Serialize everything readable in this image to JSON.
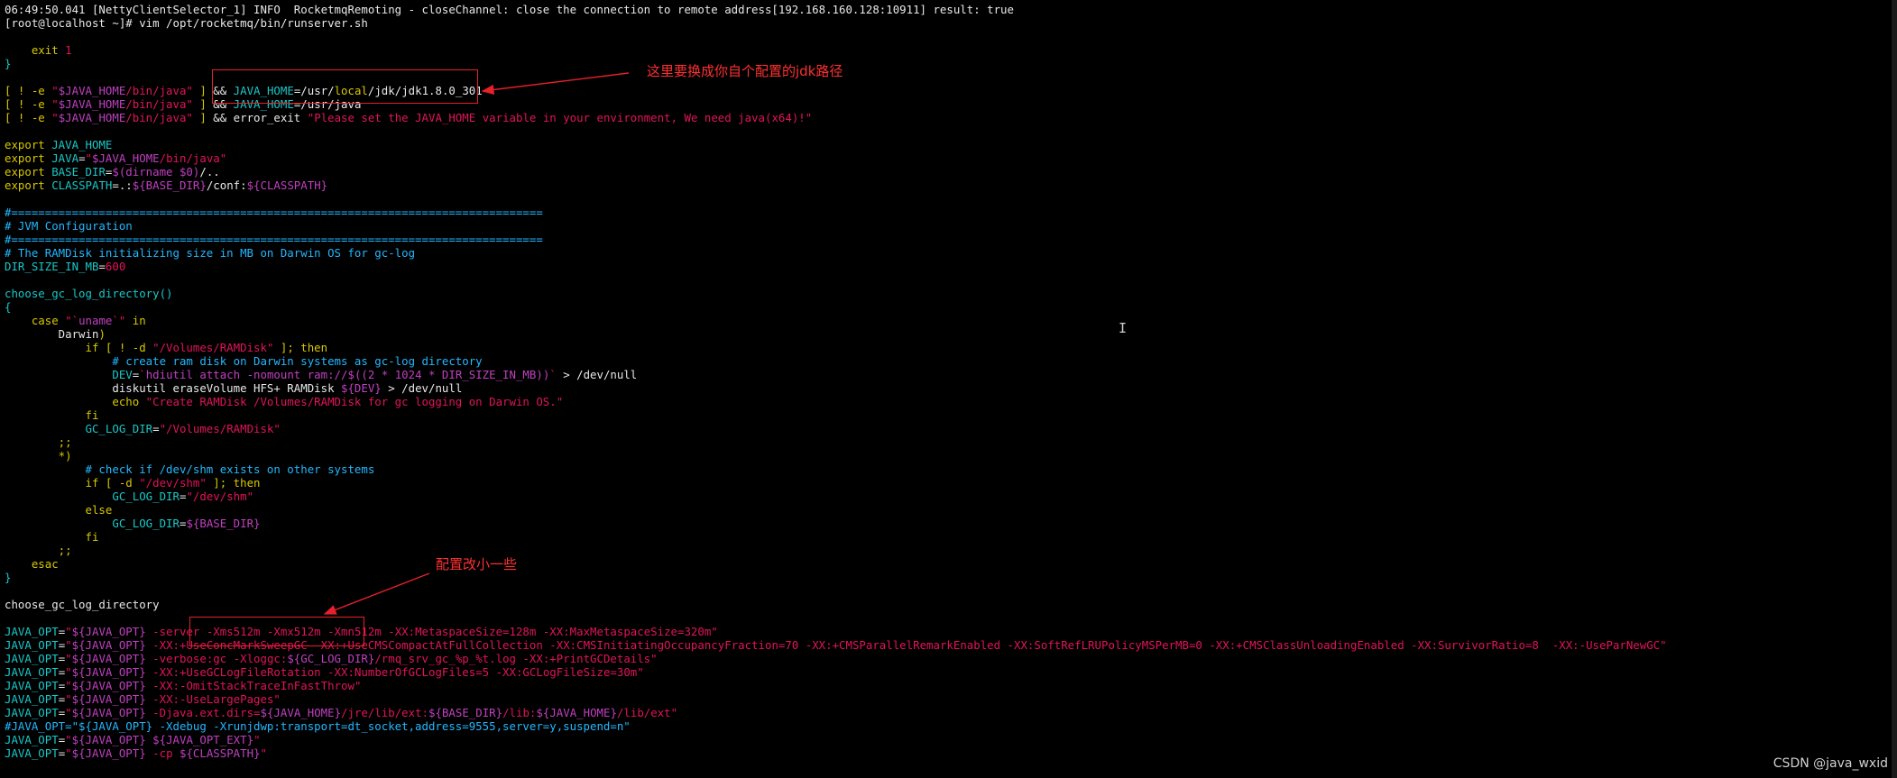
{
  "terminal": {
    "lines": [
      [
        {
          "c": "pl",
          "t": "06:49:50.041 [NettyClientSelector_1] INFO  RocketmqRemoting - closeChannel: close the connection to remote address[192.168.160.128:10911] result: true"
        }
      ],
      [
        {
          "c": "pl",
          "t": "[root@localhost ~]# vim /opt/rocketmq/bin/runserver.sh"
        }
      ],
      [],
      [
        {
          "c": "kw",
          "t": "    exit "
        },
        {
          "c": "nm",
          "t": "1"
        }
      ],
      [
        {
          "c": "vr",
          "t": "}"
        }
      ],
      [],
      [
        {
          "c": "kw",
          "t": "[ ! -e "
        },
        {
          "c": "st",
          "t": "\""
        },
        {
          "c": "va",
          "t": "$JAVA_HOME"
        },
        {
          "c": "st",
          "t": "/bin/java\""
        },
        {
          "c": "kw",
          "t": " ]"
        },
        {
          "c": "pl",
          "t": " && "
        },
        {
          "c": "vr",
          "t": "JAVA_HOME"
        },
        {
          "c": "pl",
          "t": "=/usr/"
        },
        {
          "c": "kw",
          "t": "local"
        },
        {
          "c": "pl",
          "t": "/jdk/jdk1.8.0_301"
        }
      ],
      [
        {
          "c": "kw",
          "t": "[ ! -e "
        },
        {
          "c": "st",
          "t": "\""
        },
        {
          "c": "va",
          "t": "$JAVA_HOME"
        },
        {
          "c": "st",
          "t": "/bin/java\""
        },
        {
          "c": "kw",
          "t": " ]"
        },
        {
          "c": "pl",
          "t": " && "
        },
        {
          "c": "vr",
          "t": "JAVA_HOME"
        },
        {
          "c": "pl",
          "t": "=/usr/java"
        }
      ],
      [
        {
          "c": "kw",
          "t": "[ ! -e "
        },
        {
          "c": "st",
          "t": "\""
        },
        {
          "c": "va",
          "t": "$JAVA_HOME"
        },
        {
          "c": "st",
          "t": "/bin/java\""
        },
        {
          "c": "kw",
          "t": " ]"
        },
        {
          "c": "pl",
          "t": " && error_exit "
        },
        {
          "c": "st",
          "t": "\"Please set the JAVA_HOME variable in your environment, We need java(x64)!\""
        }
      ],
      [],
      [
        {
          "c": "kw",
          "t": "export"
        },
        {
          "c": "vr",
          "t": " JAVA_HOME"
        }
      ],
      [
        {
          "c": "kw",
          "t": "export"
        },
        {
          "c": "vr",
          "t": " JAVA"
        },
        {
          "c": "pl",
          "t": "="
        },
        {
          "c": "st",
          "t": "\""
        },
        {
          "c": "va",
          "t": "$JAVA_HOME"
        },
        {
          "c": "st",
          "t": "/bin/java\""
        }
      ],
      [
        {
          "c": "kw",
          "t": "export"
        },
        {
          "c": "vr",
          "t": " BASE_DIR"
        },
        {
          "c": "pl",
          "t": "="
        },
        {
          "c": "va",
          "t": "$(dirname $0)"
        },
        {
          "c": "pl",
          "t": "/.."
        }
      ],
      [
        {
          "c": "kw",
          "t": "export"
        },
        {
          "c": "vr",
          "t": " CLASSPATH"
        },
        {
          "c": "pl",
          "t": "=.:"
        },
        {
          "c": "va",
          "t": "${BASE_DIR}"
        },
        {
          "c": "pl",
          "t": "/conf:"
        },
        {
          "c": "va",
          "t": "${CLASSPATH}"
        }
      ],
      [],
      [
        {
          "c": "cm",
          "t": "#==============================================================================="
        }
      ],
      [
        {
          "c": "cm",
          "t": "# JVM Configuration"
        }
      ],
      [
        {
          "c": "cm",
          "t": "#==============================================================================="
        }
      ],
      [
        {
          "c": "cm",
          "t": "# The RAMDisk initializing size in MB on Darwin OS for gc-log"
        }
      ],
      [
        {
          "c": "vr",
          "t": "DIR_SIZE_IN_MB"
        },
        {
          "c": "pl",
          "t": "="
        },
        {
          "c": "nm",
          "t": "600"
        }
      ],
      [],
      [
        {
          "c": "vr",
          "t": "choose_gc_log_directory()"
        }
      ],
      [
        {
          "c": "vr",
          "t": "{"
        }
      ],
      [
        {
          "c": "kw",
          "t": "    case"
        },
        {
          "c": "pl",
          "t": " "
        },
        {
          "c": "st",
          "t": "\"`"
        },
        {
          "c": "va",
          "t": "uname"
        },
        {
          "c": "st",
          "t": "`\""
        },
        {
          "c": "kw",
          "t": " in"
        }
      ],
      [
        {
          "c": "pl",
          "t": "        Darwin"
        },
        {
          "c": "kw",
          "t": ")"
        }
      ],
      [
        {
          "c": "kw",
          "t": "            if [ ! -d "
        },
        {
          "c": "st",
          "t": "\"/Volumes/RAMDisk\""
        },
        {
          "c": "kw",
          "t": " ]; then"
        }
      ],
      [
        {
          "c": "cm",
          "t": "                # create ram disk on Darwin systems as gc-log directory"
        }
      ],
      [
        {
          "c": "vr",
          "t": "                DEV"
        },
        {
          "c": "pl",
          "t": "="
        },
        {
          "c": "st",
          "t": "`"
        },
        {
          "c": "va",
          "t": "hdiutil attach -nomount ram://$((2 * 1024 * DIR_SIZE_IN_MB))"
        },
        {
          "c": "st",
          "t": "`"
        },
        {
          "c": "pl",
          "t": " > /dev/null"
        }
      ],
      [
        {
          "c": "pl",
          "t": "                diskutil eraseVolume HFS+ RAMDisk "
        },
        {
          "c": "va",
          "t": "${DEV}"
        },
        {
          "c": "pl",
          "t": " > /dev/null"
        }
      ],
      [
        {
          "c": "kw",
          "t": "                echo "
        },
        {
          "c": "st",
          "t": "\"Create RAMDisk /Volumes/RAMDisk for gc logging on Darwin OS.\""
        }
      ],
      [
        {
          "c": "kw",
          "t": "            fi"
        }
      ],
      [
        {
          "c": "vr",
          "t": "            GC_LOG_DIR"
        },
        {
          "c": "pl",
          "t": "="
        },
        {
          "c": "st",
          "t": "\"/Volumes/RAMDisk\""
        }
      ],
      [
        {
          "c": "kw",
          "t": "        ;;"
        }
      ],
      [
        {
          "c": "kw",
          "t": "        *)"
        }
      ],
      [
        {
          "c": "cm",
          "t": "            # check if /dev/shm exists on other systems"
        }
      ],
      [
        {
          "c": "kw",
          "t": "            if [ -d "
        },
        {
          "c": "st",
          "t": "\"/dev/shm\""
        },
        {
          "c": "kw",
          "t": " ]; then"
        }
      ],
      [
        {
          "c": "vr",
          "t": "                GC_LOG_DIR"
        },
        {
          "c": "pl",
          "t": "="
        },
        {
          "c": "st",
          "t": "\"/dev/shm\""
        }
      ],
      [
        {
          "c": "kw",
          "t": "            else"
        }
      ],
      [
        {
          "c": "vr",
          "t": "                GC_LOG_DIR"
        },
        {
          "c": "pl",
          "t": "="
        },
        {
          "c": "va",
          "t": "${BASE_DIR}"
        }
      ],
      [
        {
          "c": "kw",
          "t": "            fi"
        }
      ],
      [
        {
          "c": "kw",
          "t": "        ;;"
        }
      ],
      [
        {
          "c": "kw",
          "t": "    esac"
        }
      ],
      [
        {
          "c": "vr",
          "t": "}"
        }
      ],
      [],
      [
        {
          "c": "pl",
          "t": "choose_gc_log_directory"
        }
      ],
      [],
      [
        {
          "c": "vr",
          "t": "JAVA_OPT"
        },
        {
          "c": "pl",
          "t": "="
        },
        {
          "c": "st",
          "t": "\""
        },
        {
          "c": "va",
          "t": "${JAVA_OPT}"
        },
        {
          "c": "st",
          "t": " -server -Xms512m -Xmx512m -Xmn512m -XX:MetaspaceSize=128m -XX:MaxMetaspaceSize=320m\""
        }
      ],
      [
        {
          "c": "vr",
          "t": "JAVA_OPT"
        },
        {
          "c": "pl",
          "t": "="
        },
        {
          "c": "st",
          "t": "\""
        },
        {
          "c": "va",
          "t": "${JAVA_OPT}"
        },
        {
          "c": "st",
          "t": " -XX:+UseConcMarkSweepGC -XX:+UseCMSCompactAtFullCollection -XX:CMSInitiatingOccupancyFraction=70 -XX:+CMSParallelRemarkEnabled -XX:SoftRefLRUPolicyMSPerMB=0 -XX:+CMSClassUnloadingEnabled -XX:SurvivorRatio=8  -XX:-UseParNewGC\""
        }
      ],
      [
        {
          "c": "vr",
          "t": "JAVA_OPT"
        },
        {
          "c": "pl",
          "t": "="
        },
        {
          "c": "st",
          "t": "\""
        },
        {
          "c": "va",
          "t": "${JAVA_OPT}"
        },
        {
          "c": "st",
          "t": " -verbose:gc -Xloggc:"
        },
        {
          "c": "va",
          "t": "${GC_LOG_DIR}"
        },
        {
          "c": "st",
          "t": "/rmq_srv_gc_%p_%t.log -XX:+PrintGCDetails\""
        }
      ],
      [
        {
          "c": "vr",
          "t": "JAVA_OPT"
        },
        {
          "c": "pl",
          "t": "="
        },
        {
          "c": "st",
          "t": "\""
        },
        {
          "c": "va",
          "t": "${JAVA_OPT}"
        },
        {
          "c": "st",
          "t": " -XX:+UseGCLogFileRotation -XX:NumberOfGCLogFiles=5 -XX:GCLogFileSize=30m\""
        }
      ],
      [
        {
          "c": "vr",
          "t": "JAVA_OPT"
        },
        {
          "c": "pl",
          "t": "="
        },
        {
          "c": "st",
          "t": "\""
        },
        {
          "c": "va",
          "t": "${JAVA_OPT}"
        },
        {
          "c": "st",
          "t": " -XX:-OmitStackTraceInFastThrow\""
        }
      ],
      [
        {
          "c": "vr",
          "t": "JAVA_OPT"
        },
        {
          "c": "pl",
          "t": "="
        },
        {
          "c": "st",
          "t": "\""
        },
        {
          "c": "va",
          "t": "${JAVA_OPT}"
        },
        {
          "c": "st",
          "t": " -XX:-UseLargePages\""
        }
      ],
      [
        {
          "c": "vr",
          "t": "JAVA_OPT"
        },
        {
          "c": "pl",
          "t": "="
        },
        {
          "c": "st",
          "t": "\""
        },
        {
          "c": "va",
          "t": "${JAVA_OPT}"
        },
        {
          "c": "st",
          "t": " -Djava.ext.dirs="
        },
        {
          "c": "va",
          "t": "${JAVA_HOME}"
        },
        {
          "c": "st",
          "t": "/jre/lib/ext:"
        },
        {
          "c": "va",
          "t": "${BASE_DIR}"
        },
        {
          "c": "st",
          "t": "/lib:"
        },
        {
          "c": "va",
          "t": "${JAVA_HOME}"
        },
        {
          "c": "st",
          "t": "/lib/ext\""
        }
      ],
      [
        {
          "c": "cm",
          "t": "#JAVA_OPT=\"${JAVA_OPT} -Xdebug -Xrunjdwp:transport=dt_socket,address=9555,server=y,suspend=n\""
        }
      ],
      [
        {
          "c": "vr",
          "t": "JAVA_OPT"
        },
        {
          "c": "pl",
          "t": "="
        },
        {
          "c": "st",
          "t": "\""
        },
        {
          "c": "va",
          "t": "${JAVA_OPT}"
        },
        {
          "c": "pl",
          "t": " "
        },
        {
          "c": "va",
          "t": "${JAVA_OPT_EXT}"
        },
        {
          "c": "st",
          "t": "\""
        }
      ],
      [
        {
          "c": "vr",
          "t": "JAVA_OPT"
        },
        {
          "c": "pl",
          "t": "="
        },
        {
          "c": "st",
          "t": "\""
        },
        {
          "c": "va",
          "t": "${JAVA_OPT}"
        },
        {
          "c": "st",
          "t": " -cp "
        },
        {
          "c": "va",
          "t": "${CLASSPATH}"
        },
        {
          "c": "st",
          "t": "\""
        }
      ]
    ]
  },
  "annotations": {
    "jdk_note": "这里要换成你自个配置的jdk路径",
    "mem_note": "配置改小一些"
  },
  "watermark": "CSDN @java_wxid",
  "cursor_glyph": "I",
  "colors": {
    "background": "#000000",
    "comment": "#22b8ff",
    "string": "#e0145a",
    "keyword": "#d8c800",
    "variable": "#19c8c8",
    "expansion": "#c040c0",
    "annotation": "#ff3030"
  }
}
